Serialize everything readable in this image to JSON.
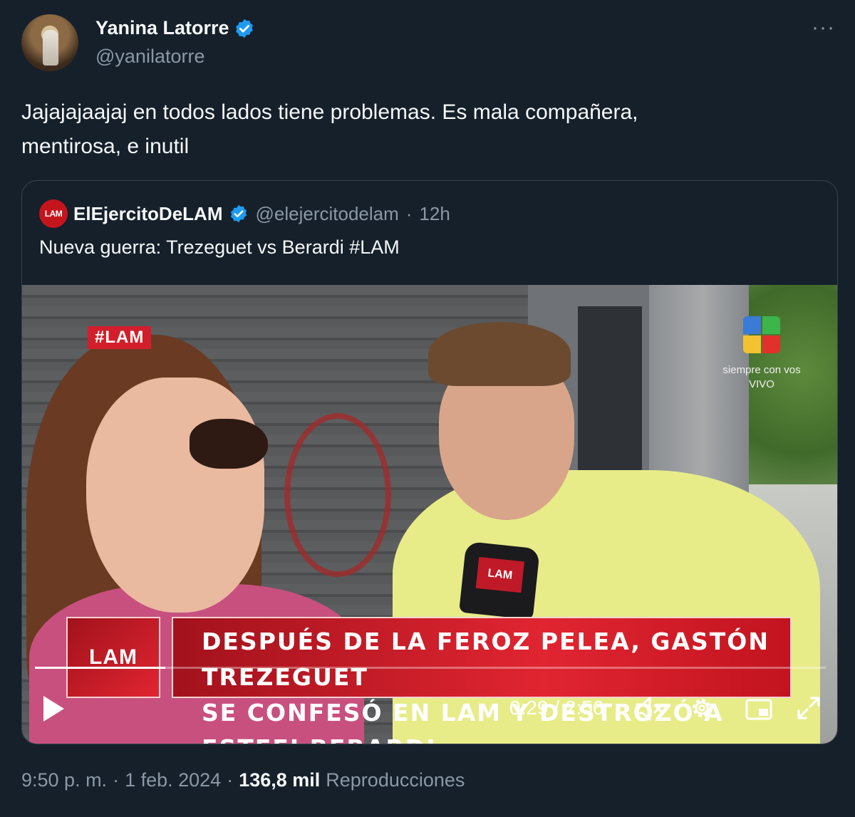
{
  "author": {
    "display_name": "Yanina Latorre",
    "handle": "@yanilatorre",
    "verified": true,
    "avatar": "profile-photo"
  },
  "more_icon": "ellipsis-icon",
  "more_label": "···",
  "tweet": {
    "text_line1": "Jajajajaajaj en todos lados tiene problemas. Es mala compañera,",
    "text_line2": "mentirosa, e inutil"
  },
  "quoted": {
    "avatar_label": "LAM",
    "display_name": "ElEjercitoDeLAM",
    "handle": "@elejercitodelam",
    "separator": "·",
    "time_ago": "12h",
    "text": "Nueva guerra: Trezeguet vs Berardi #LAM",
    "video": {
      "hashtag": "#LAM",
      "channel_tagline_1": "siempre con vos",
      "channel_tagline_2": "VIVO",
      "lower_third_logo": "LAM",
      "mic_logo": "LAM",
      "headline_line1": "DESPUÉS DE LA FEROZ PELEA, GASTÓN TREZEGUET",
      "headline_line2": "SE CONFESÓ EN LAM Y DESTROZÓ A ESTEFI BERARDI",
      "time_display": "0:29 / 2:56",
      "progress_fraction": 0.165,
      "muted": true
    }
  },
  "footer": {
    "time": "9:50 p. m.",
    "dot1": "·",
    "date": "1 feb. 2024",
    "dot2": "·",
    "views_count": "136,8 mil",
    "views_label": "Reproducciones"
  },
  "colors": {
    "background": "#15202b",
    "verified_blue": "#1d9bf0",
    "secondary_text": "#8b98a5",
    "lam_red": "#e02531"
  }
}
